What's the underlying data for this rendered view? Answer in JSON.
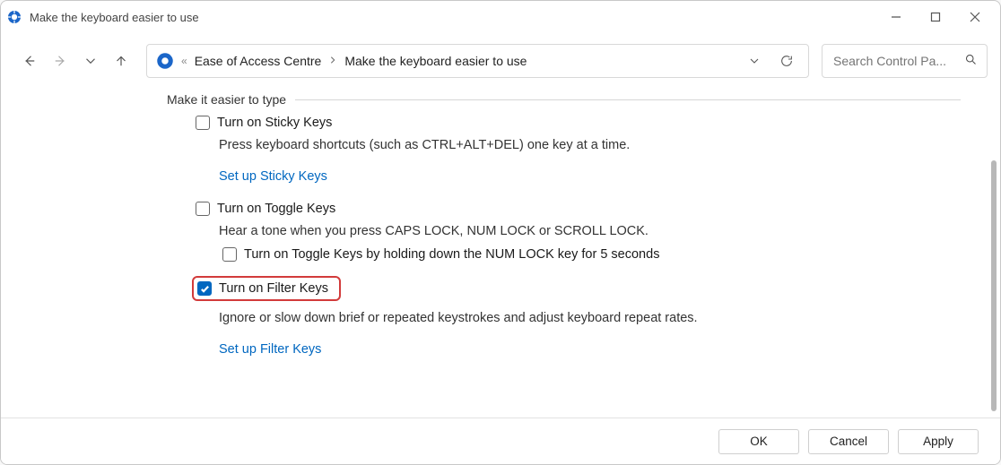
{
  "window": {
    "title": "Make the keyboard easier to use"
  },
  "breadcrumb": {
    "root_glyph": "«",
    "parent": "Ease of Access Centre",
    "current": "Make the keyboard easier to use"
  },
  "search": {
    "placeholder": "Search Control Pa..."
  },
  "content": {
    "group_heading": "Make it easier to type",
    "sticky": {
      "label": "Turn on Sticky Keys",
      "checked": false,
      "desc": "Press keyboard shortcuts (such as CTRL+ALT+DEL) one key at a time.",
      "link": "Set up Sticky Keys"
    },
    "toggle": {
      "label": "Turn on Toggle Keys",
      "checked": false,
      "desc": "Hear a tone when you press CAPS LOCK, NUM LOCK or SCROLL LOCK.",
      "sub_label": "Turn on Toggle Keys by holding down the NUM LOCK key for 5 seconds",
      "sub_checked": false
    },
    "filter": {
      "label": "Turn on Filter Keys",
      "checked": true,
      "highlighted": true,
      "desc": "Ignore or slow down brief or repeated keystrokes and adjust keyboard repeat rates.",
      "link": "Set up Filter Keys"
    }
  },
  "buttons": {
    "ok": "OK",
    "cancel": "Cancel",
    "apply": "Apply"
  }
}
